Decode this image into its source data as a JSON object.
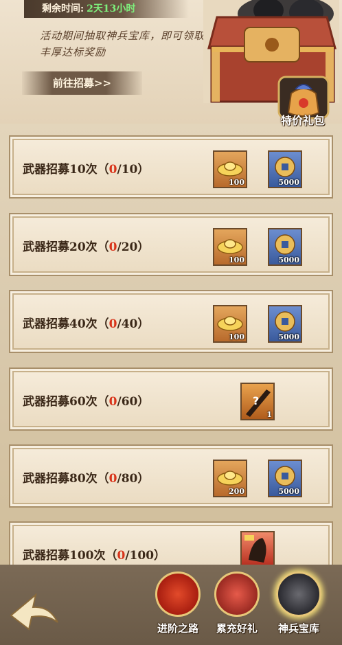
{
  "header": {
    "time_label": "剩余时间:",
    "time_value": "2天13小时",
    "description": "活动期间抽取神兵宝库，即可领取丰厚达标奖励",
    "goto_label": "前往招募>>"
  },
  "gift": {
    "label": "特价礼包"
  },
  "cards": [
    {
      "prefix": "武器招募10次",
      "open": "（",
      "current": "0",
      "rest": "/10）",
      "items": [
        {
          "kind": "gold-ingot",
          "qty": "100"
        },
        {
          "kind": "copper-coin",
          "qty": "5000"
        }
      ]
    },
    {
      "prefix": "武器招募20次",
      "open": "（",
      "current": "0",
      "rest": "/20）",
      "items": [
        {
          "kind": "gold-ingot",
          "qty": "100"
        },
        {
          "kind": "copper-coin",
          "qty": "5000"
        }
      ]
    },
    {
      "prefix": "武器招募40次",
      "open": "（",
      "current": "0",
      "rest": "/40）",
      "items": [
        {
          "kind": "gold-ingot",
          "qty": "100"
        },
        {
          "kind": "copper-coin",
          "qty": "5000"
        }
      ]
    },
    {
      "prefix": "武器招募60次",
      "open": "（",
      "current": "0",
      "rest": "/60）",
      "items": [
        {
          "kind": "random-weapon",
          "qty": "1"
        }
      ]
    },
    {
      "prefix": "武器招募80次",
      "open": "（",
      "current": "0",
      "rest": "/80）",
      "items": [
        {
          "kind": "gold-ingot",
          "qty": "200"
        },
        {
          "kind": "copper-coin",
          "qty": "5000"
        }
      ]
    },
    {
      "prefix": "武器招募100次",
      "open": "（",
      "current": "0",
      "rest": "/100）",
      "items": [
        {
          "kind": "hero-card",
          "qty": ""
        }
      ]
    }
  ],
  "nav": {
    "advance": "进阶之路",
    "recharge": "累充好礼",
    "armory": "神兵宝库"
  },
  "colors": {
    "progress_current": "#d8341b",
    "time_value": "#7ef07c"
  }
}
